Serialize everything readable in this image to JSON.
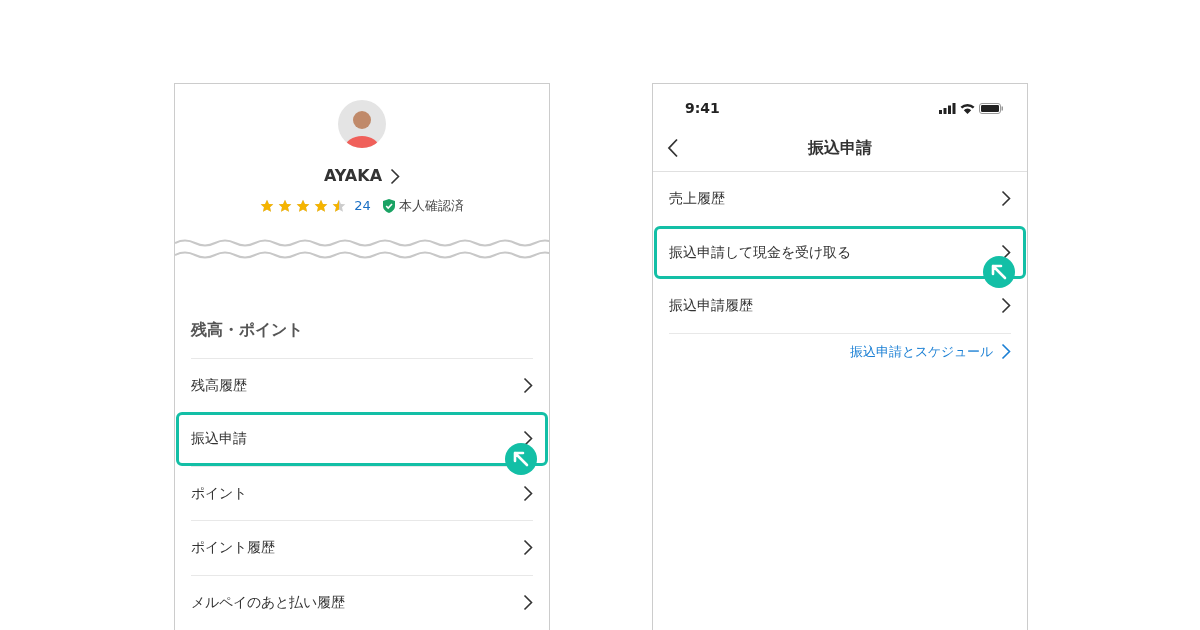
{
  "left_screen": {
    "profile": {
      "name": "AYAKA",
      "stars": 4.5,
      "rating_count": "24",
      "verified_label": "本人確認済"
    },
    "section_title": "残高・ポイント",
    "rows": [
      {
        "label": "残高履歴",
        "highlighted": false
      },
      {
        "label": "振込申請",
        "highlighted": true
      },
      {
        "label": "ポイント",
        "highlighted": false
      },
      {
        "label": "ポイント履歴",
        "highlighted": false
      },
      {
        "label": "メルペイのあと払い履歴",
        "highlighted": false
      }
    ]
  },
  "right_screen": {
    "status_bar": {
      "time": "9:41"
    },
    "title": "振込申請",
    "rows": [
      {
        "label": "売上履歴",
        "highlighted": false
      },
      {
        "label": "振込申請して現金を受け取る",
        "highlighted": true
      },
      {
        "label": "振込申請履歴",
        "highlighted": false
      }
    ],
    "link": "振込申請とスケジュール"
  }
}
